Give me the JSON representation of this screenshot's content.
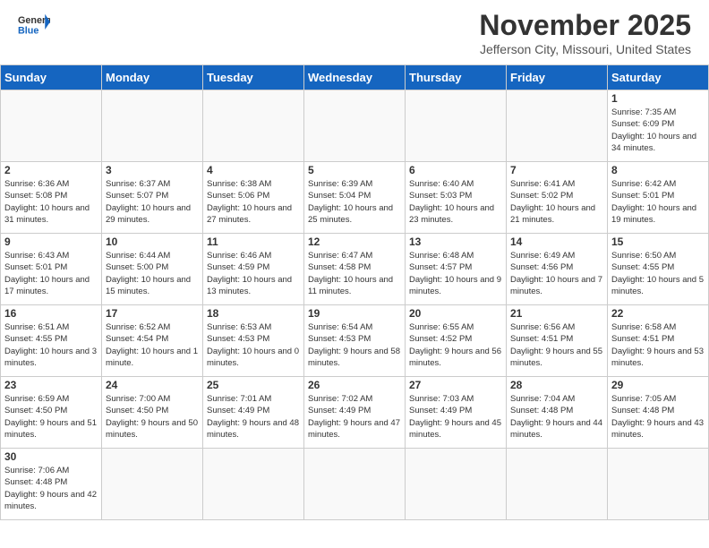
{
  "header": {
    "logo_general": "General",
    "logo_blue": "Blue",
    "month_title": "November 2025",
    "subtitle": "Jefferson City, Missouri, United States"
  },
  "days_of_week": [
    "Sunday",
    "Monday",
    "Tuesday",
    "Wednesday",
    "Thursday",
    "Friday",
    "Saturday"
  ],
  "weeks": [
    [
      {
        "day": "",
        "info": ""
      },
      {
        "day": "",
        "info": ""
      },
      {
        "day": "",
        "info": ""
      },
      {
        "day": "",
        "info": ""
      },
      {
        "day": "",
        "info": ""
      },
      {
        "day": "",
        "info": ""
      },
      {
        "day": "1",
        "info": "Sunrise: 7:35 AM\nSunset: 6:09 PM\nDaylight: 10 hours and 34 minutes."
      }
    ],
    [
      {
        "day": "2",
        "info": "Sunrise: 6:36 AM\nSunset: 5:08 PM\nDaylight: 10 hours and 31 minutes."
      },
      {
        "day": "3",
        "info": "Sunrise: 6:37 AM\nSunset: 5:07 PM\nDaylight: 10 hours and 29 minutes."
      },
      {
        "day": "4",
        "info": "Sunrise: 6:38 AM\nSunset: 5:06 PM\nDaylight: 10 hours and 27 minutes."
      },
      {
        "day": "5",
        "info": "Sunrise: 6:39 AM\nSunset: 5:04 PM\nDaylight: 10 hours and 25 minutes."
      },
      {
        "day": "6",
        "info": "Sunrise: 6:40 AM\nSunset: 5:03 PM\nDaylight: 10 hours and 23 minutes."
      },
      {
        "day": "7",
        "info": "Sunrise: 6:41 AM\nSunset: 5:02 PM\nDaylight: 10 hours and 21 minutes."
      },
      {
        "day": "8",
        "info": "Sunrise: 6:42 AM\nSunset: 5:01 PM\nDaylight: 10 hours and 19 minutes."
      }
    ],
    [
      {
        "day": "9",
        "info": "Sunrise: 6:43 AM\nSunset: 5:01 PM\nDaylight: 10 hours and 17 minutes."
      },
      {
        "day": "10",
        "info": "Sunrise: 6:44 AM\nSunset: 5:00 PM\nDaylight: 10 hours and 15 minutes."
      },
      {
        "day": "11",
        "info": "Sunrise: 6:46 AM\nSunset: 4:59 PM\nDaylight: 10 hours and 13 minutes."
      },
      {
        "day": "12",
        "info": "Sunrise: 6:47 AM\nSunset: 4:58 PM\nDaylight: 10 hours and 11 minutes."
      },
      {
        "day": "13",
        "info": "Sunrise: 6:48 AM\nSunset: 4:57 PM\nDaylight: 10 hours and 9 minutes."
      },
      {
        "day": "14",
        "info": "Sunrise: 6:49 AM\nSunset: 4:56 PM\nDaylight: 10 hours and 7 minutes."
      },
      {
        "day": "15",
        "info": "Sunrise: 6:50 AM\nSunset: 4:55 PM\nDaylight: 10 hours and 5 minutes."
      }
    ],
    [
      {
        "day": "16",
        "info": "Sunrise: 6:51 AM\nSunset: 4:55 PM\nDaylight: 10 hours and 3 minutes."
      },
      {
        "day": "17",
        "info": "Sunrise: 6:52 AM\nSunset: 4:54 PM\nDaylight: 10 hours and 1 minute."
      },
      {
        "day": "18",
        "info": "Sunrise: 6:53 AM\nSunset: 4:53 PM\nDaylight: 10 hours and 0 minutes."
      },
      {
        "day": "19",
        "info": "Sunrise: 6:54 AM\nSunset: 4:53 PM\nDaylight: 9 hours and 58 minutes."
      },
      {
        "day": "20",
        "info": "Sunrise: 6:55 AM\nSunset: 4:52 PM\nDaylight: 9 hours and 56 minutes."
      },
      {
        "day": "21",
        "info": "Sunrise: 6:56 AM\nSunset: 4:51 PM\nDaylight: 9 hours and 55 minutes."
      },
      {
        "day": "22",
        "info": "Sunrise: 6:58 AM\nSunset: 4:51 PM\nDaylight: 9 hours and 53 minutes."
      }
    ],
    [
      {
        "day": "23",
        "info": "Sunrise: 6:59 AM\nSunset: 4:50 PM\nDaylight: 9 hours and 51 minutes."
      },
      {
        "day": "24",
        "info": "Sunrise: 7:00 AM\nSunset: 4:50 PM\nDaylight: 9 hours and 50 minutes."
      },
      {
        "day": "25",
        "info": "Sunrise: 7:01 AM\nSunset: 4:49 PM\nDaylight: 9 hours and 48 minutes."
      },
      {
        "day": "26",
        "info": "Sunrise: 7:02 AM\nSunset: 4:49 PM\nDaylight: 9 hours and 47 minutes."
      },
      {
        "day": "27",
        "info": "Sunrise: 7:03 AM\nSunset: 4:49 PM\nDaylight: 9 hours and 45 minutes."
      },
      {
        "day": "28",
        "info": "Sunrise: 7:04 AM\nSunset: 4:48 PM\nDaylight: 9 hours and 44 minutes."
      },
      {
        "day": "29",
        "info": "Sunrise: 7:05 AM\nSunset: 4:48 PM\nDaylight: 9 hours and 43 minutes."
      }
    ],
    [
      {
        "day": "30",
        "info": "Sunrise: 7:06 AM\nSunset: 4:48 PM\nDaylight: 9 hours and 42 minutes."
      },
      {
        "day": "",
        "info": ""
      },
      {
        "day": "",
        "info": ""
      },
      {
        "day": "",
        "info": ""
      },
      {
        "day": "",
        "info": ""
      },
      {
        "day": "",
        "info": ""
      },
      {
        "day": "",
        "info": ""
      }
    ]
  ]
}
